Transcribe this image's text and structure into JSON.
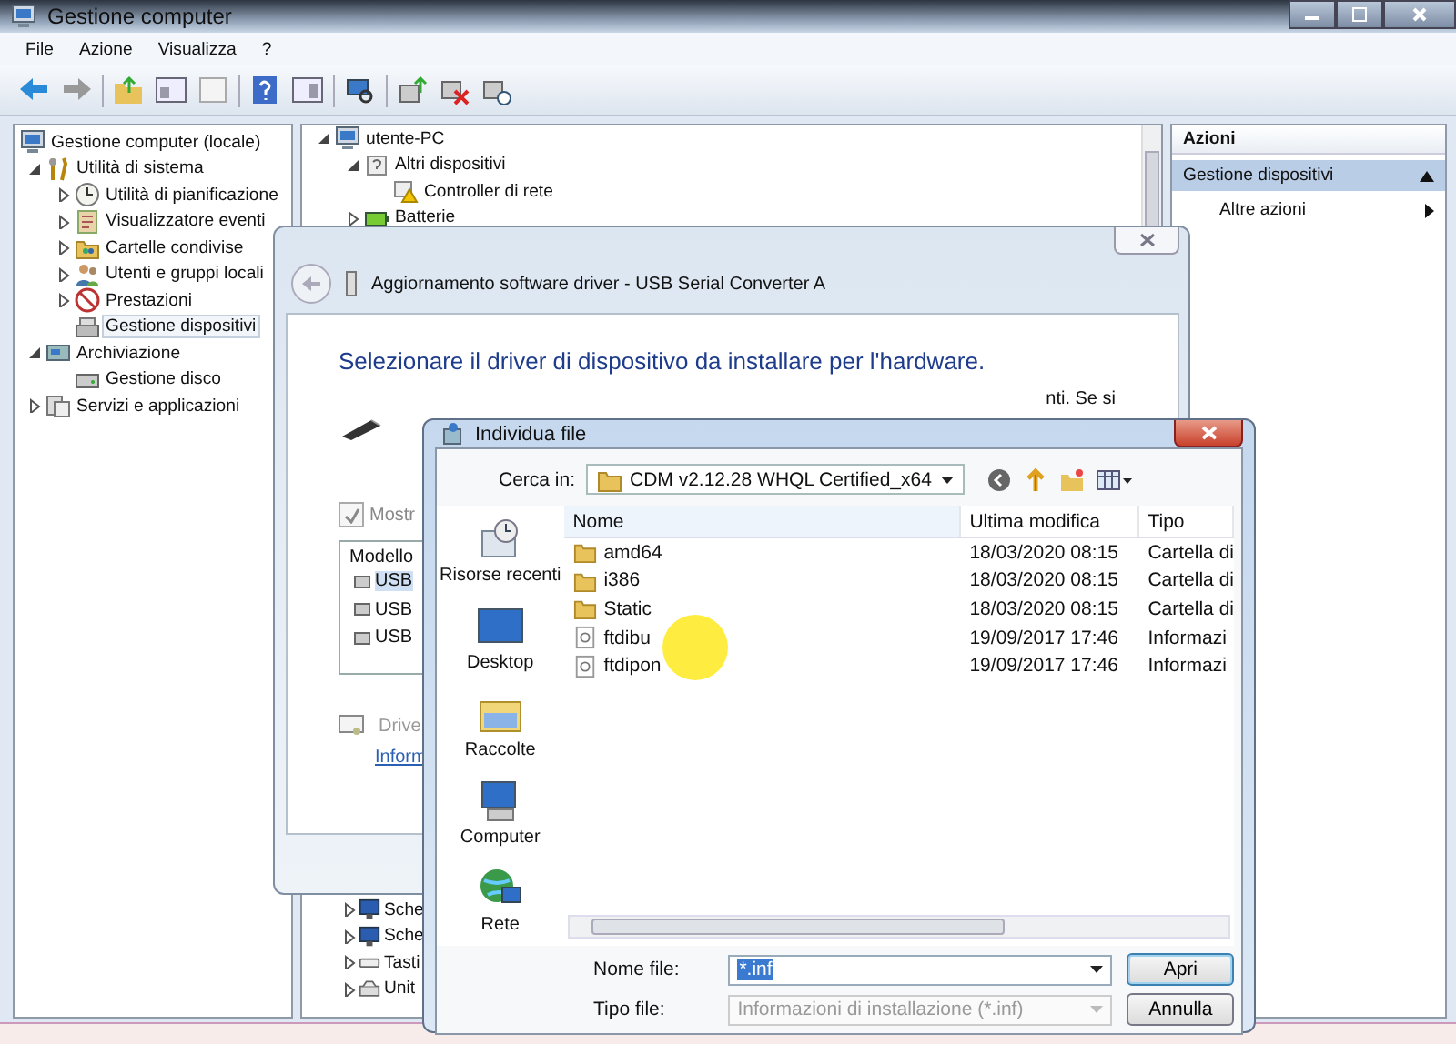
{
  "main_window": {
    "title": "Gestione computer",
    "menu": [
      "File",
      "Azione",
      "Visualizza",
      "?"
    ],
    "nav_tree": [
      {
        "label": "Gestione computer (locale)",
        "kind": "computer",
        "selected": false,
        "children": [
          {
            "label": "Utilità di sistema",
            "kind": "tools",
            "expanded": true,
            "selected": false,
            "children": [
              {
                "label": "Utilità di pianificazione",
                "kind": "clock",
                "expanded": false,
                "selected": false
              },
              {
                "label": "Visualizzatore eventi",
                "kind": "log",
                "expanded": false,
                "selected": false
              },
              {
                "label": "Cartelle condivise",
                "kind": "share",
                "expanded": false,
                "selected": false
              },
              {
                "label": "Utenti e gruppi locali",
                "kind": "users",
                "expanded": false,
                "selected": false
              },
              {
                "label": "Prestazioni",
                "kind": "performance",
                "expanded": false,
                "selected": false
              },
              {
                "label": "Gestione dispositivi",
                "kind": "devices",
                "selected": true
              }
            ]
          },
          {
            "label": "Archiviazione",
            "kind": "storage",
            "expanded": true,
            "selected": false,
            "children": [
              {
                "label": "Gestione disco",
                "kind": "disk",
                "selected": false
              }
            ]
          },
          {
            "label": "Servizi e applicazioni",
            "kind": "services",
            "expanded": false,
            "selected": false
          }
        ]
      }
    ],
    "device_tree": [
      {
        "label": "utente-PC",
        "kind": "computer",
        "expanded": true,
        "children": [
          {
            "label": "Altri dispositivi",
            "kind": "unknown",
            "expanded": true,
            "children": [
              {
                "label": "Controller di rete",
                "kind": "warning"
              }
            ]
          },
          {
            "label": "Batterie",
            "kind": "battery",
            "expanded": false
          }
        ]
      }
    ],
    "device_tree_lower": [
      {
        "label": "Sche",
        "kind": "display",
        "expanded": false
      },
      {
        "label": "Sche",
        "kind": "display",
        "expanded": false
      },
      {
        "label": "Tasti",
        "kind": "keyboard",
        "expanded": false
      },
      {
        "label": "Unit",
        "kind": "drive",
        "expanded": false
      }
    ],
    "actions": {
      "title": "Azioni",
      "sections": [
        {
          "label": "Gestione dispositivi",
          "expanded": true,
          "items": [
            "Altre azioni"
          ]
        }
      ]
    }
  },
  "wizard": {
    "title": "Aggiornamento software driver - USB Serial Converter A",
    "heading": "Selezionare il driver di dispositivo da installare per l'hardware.",
    "text_fragment": "nti. Se si",
    "checkbox": {
      "label": "Mostr",
      "checked": true
    },
    "list_header": "Modello",
    "list_items": [
      {
        "label": "USB",
        "selected": true
      },
      {
        "label": "USB",
        "selected": false
      },
      {
        "label": "USB",
        "selected": false
      }
    ],
    "driver_note": "Drive",
    "link": "Inform"
  },
  "file_dialog": {
    "title": "Individua file",
    "look_in_label": "Cerca in:",
    "look_in": "CDM v2.12.28 WHQL Certified_x64",
    "places": [
      {
        "label": "Risorse recenti",
        "kind": "recent"
      },
      {
        "label": "Desktop",
        "kind": "desktop"
      },
      {
        "label": "Raccolte",
        "kind": "library"
      },
      {
        "label": "Computer",
        "kind": "computer"
      },
      {
        "label": "Rete",
        "kind": "network"
      }
    ],
    "columns": [
      "Nome",
      "Ultima modifica",
      "Tipo"
    ],
    "files": [
      {
        "name": "amd64",
        "kind": "folder",
        "modified": "18/03/2020 08:15",
        "type": "Cartella di"
      },
      {
        "name": "i386",
        "kind": "folder",
        "modified": "18/03/2020 08:15",
        "type": "Cartella di"
      },
      {
        "name": "Static",
        "kind": "folder",
        "modified": "18/03/2020 08:15",
        "type": "Cartella di"
      },
      {
        "name": "ftdibu",
        "kind": "file",
        "modified": "19/09/2017 17:46",
        "type": "Informazi"
      },
      {
        "name": "ftdipon",
        "kind": "file",
        "modified": "19/09/2017 17:46",
        "type": "Informazi"
      }
    ],
    "file_name_label": "Nome file:",
    "file_name": "*.inf",
    "file_type_label": "Tipo file:",
    "file_type": "Informazioni di installazione (*.inf)",
    "buttons": [
      "Apri",
      "Annulla"
    ]
  }
}
